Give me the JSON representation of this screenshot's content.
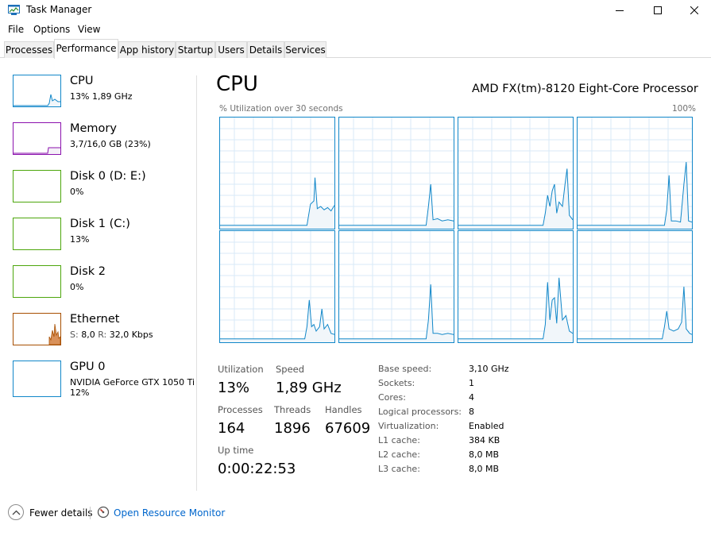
{
  "window": {
    "title": "Task Manager"
  },
  "menu": [
    "File",
    "Options",
    "View"
  ],
  "tabs": [
    {
      "label": "Processes",
      "active": false
    },
    {
      "label": "Performance",
      "active": true
    },
    {
      "label": "App history",
      "active": false
    },
    {
      "label": "Startup",
      "active": false
    },
    {
      "label": "Users",
      "active": false
    },
    {
      "label": "Details",
      "active": false
    },
    {
      "label": "Services",
      "active": false
    }
  ],
  "resources": [
    {
      "name": "CPU",
      "detail": "13%  1,89 GHz",
      "color": "#1187c9"
    },
    {
      "name": "Memory",
      "detail": "3,7/16,0 GB (23%)",
      "color": "#8b12ae"
    },
    {
      "name": "Disk 0 (D: E:)",
      "detail": "0%",
      "color": "#4da60c"
    },
    {
      "name": "Disk 1 (C:)",
      "detail": "13%",
      "color": "#4da60c"
    },
    {
      "name": "Disk 2",
      "detail": "0%",
      "color": "#4da60c"
    },
    {
      "name": "Ethernet",
      "detail_s_label": "S:",
      "detail_s_value": "8,0",
      "detail_r_label": "R:",
      "detail_r_value": "32,0 Kbps",
      "color": "#a74f01"
    },
    {
      "name": "GPU 0",
      "detail": "NVIDIA GeForce GTX 1050 Ti",
      "detail2": "12%",
      "color": "#1187c9"
    }
  ],
  "cpu": {
    "title": "CPU",
    "model": "AMD FX(tm)-8120 Eight-Core Processor",
    "graph_caption": "% Utilization over 30 seconds",
    "graph_max": "100%",
    "core_count_graphs": 8
  },
  "stats": {
    "utilization_label": "Utilization",
    "utilization": "13%",
    "speed_label": "Speed",
    "speed": "1,89 GHz",
    "processes_label": "Processes",
    "processes": "164",
    "threads_label": "Threads",
    "threads": "1896",
    "handles_label": "Handles",
    "handles": "67609",
    "uptime_label": "Up time",
    "uptime": "0:00:22:53"
  },
  "specs": [
    {
      "label": "Base speed:",
      "value": "3,10 GHz"
    },
    {
      "label": "Sockets:",
      "value": "1"
    },
    {
      "label": "Cores:",
      "value": "4"
    },
    {
      "label": "Logical processors:",
      "value": "8"
    },
    {
      "label": "Virtualization:",
      "value": "Enabled"
    },
    {
      "label": "L1 cache:",
      "value": "384 KB"
    },
    {
      "label": "L2 cache:",
      "value": "8,0 MB"
    },
    {
      "label": "L3 cache:",
      "value": "8,0 MB"
    }
  ],
  "footer": {
    "fewer_details": "Fewer details",
    "open_monitor": "Open Resource Monitor"
  }
}
